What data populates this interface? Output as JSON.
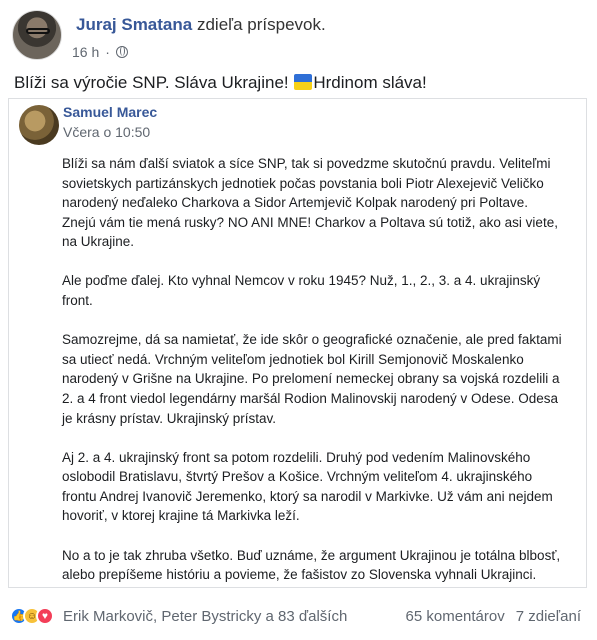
{
  "post": {
    "author": "Juraj Smatana",
    "action": "zdieľa príspevok.",
    "time": "16 h",
    "text_before_flag": "Blíži sa výročie SNP. Sláva Ukrajine!",
    "text_after_flag": "Hrdinom sláva!",
    "flag_icon": "ukraine-flag-icon",
    "flag_colors": [
      "#2f6fd6",
      "#f7d117"
    ]
  },
  "shared": {
    "author": "Samuel Marec",
    "time": "Včera o 10:50",
    "paragraphs": [
      "Blíži sa nám ďalší sviatok a síce SNP, tak si povedzme skutočnú pravdu. Veliteľmi sovietskych partizánskych jednotiek počas povstania boli Piotr Alexejevič Veličko narodený neďaleko Charkova a Sidor Artemjevič Kolpak narodený pri Poltave. Znejú vám tie mená rusky? NO ANI MNE! Charkov a Poltava sú totiž, ako asi viete, na Ukrajine.",
      "Ale poďme ďalej. Kto vyhnal Nemcov v roku 1945? Nuž, 1., 2., 3. a 4. ukrajinský front.",
      "Samozrejme, dá sa namietať, že ide skôr o geografické označenie, ale pred faktami sa utiecť nedá. Vrchným veliteľom jednotiek bol Kirill Semjonovič Moskalenko narodený v Grišne na Ukrajine. Po prelomení nemeckej obrany sa vojská rozdelili a 2. a 4 front viedol legendárny maršál Rodion Malinovskij narodený v Odese. Odesa je krásny prístav. Ukrajinský prístav.",
      "Aj 2. a 4. ukrajinský front sa potom rozdelili. Druhý pod vedením Malinovského oslobodil Bratislavu, štvrtý Prešov a Košice. Vrchným veliteľom 4. ukrajinského frontu Andrej Ivanovič Jeremenko, ktorý sa narodil v Markivke. Už vám ani nejdem hovoriť, v ktorej krajine tá Markivka leží.",
      "No a to je tak zhruba všetko. Buď uznáme, že argument Ukrajinou je totálna blbosť, alebo prepíšeme históriu a povieme, že fašistov zo Slovenska vyhnali Ukrajinci."
    ]
  },
  "footer": {
    "reactors": "Erik Markovič, Peter Bystricky a 83 ďalších",
    "comments": "65 komentárov",
    "shares": "7 zdieľaní"
  }
}
